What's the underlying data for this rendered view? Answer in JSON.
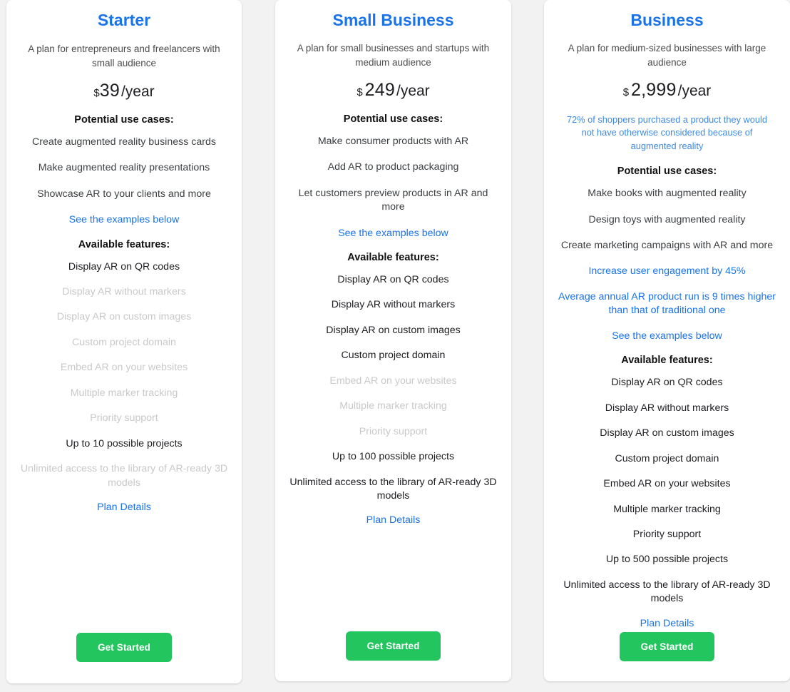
{
  "plans": [
    {
      "name": "Starter",
      "description": "A plan for entrepreneurs and freelancers with small audience",
      "price_currency": "$",
      "price_amount": "39",
      "price_period": "/year",
      "stat_note": null,
      "use_cases_heading": "Potential use cases:",
      "use_cases": [
        "Create augmented reality business cards",
        "Make augmented reality presentations",
        "Showcase AR to your clients and more"
      ],
      "examples_link": "See the examples below",
      "features_heading": "Available features:",
      "features": [
        {
          "label": "Display AR on QR codes",
          "enabled": true
        },
        {
          "label": "Display AR without markers",
          "enabled": false
        },
        {
          "label": "Display AR on custom images",
          "enabled": false
        },
        {
          "label": "Custom project domain",
          "enabled": false
        },
        {
          "label": "Embed AR on your websites",
          "enabled": false
        },
        {
          "label": "Multiple marker tracking",
          "enabled": false
        },
        {
          "label": "Priority support",
          "enabled": false
        },
        {
          "label": "Up to 10 possible projects",
          "enabled": true
        },
        {
          "label": "Unlimited access to the library of AR-ready 3D models",
          "enabled": false
        }
      ],
      "plan_details_link": "Plan Details",
      "cta_label": "Get Started"
    },
    {
      "name": "Small Business",
      "description": "A plan for small businesses and startups with medium audience",
      "price_currency": "$",
      "price_amount": "249",
      "price_period": "/year",
      "stat_note": null,
      "use_cases_heading": "Potential use cases:",
      "use_cases": [
        "Make consumer products with AR",
        "Add AR to product packaging",
        "Let customers preview products in AR and more"
      ],
      "examples_link": "See the examples below",
      "features_heading": "Available features:",
      "features": [
        {
          "label": "Display AR on QR codes",
          "enabled": true
        },
        {
          "label": "Display AR without markers",
          "enabled": true
        },
        {
          "label": "Display AR on custom images",
          "enabled": true
        },
        {
          "label": "Custom project domain",
          "enabled": true
        },
        {
          "label": "Embed AR on your websites",
          "enabled": false
        },
        {
          "label": "Multiple marker tracking",
          "enabled": false
        },
        {
          "label": "Priority support",
          "enabled": false
        },
        {
          "label": "Up to 100 possible projects",
          "enabled": true
        },
        {
          "label": "Unlimited access to the library of AR-ready 3D models",
          "enabled": true
        }
      ],
      "plan_details_link": "Plan Details",
      "cta_label": "Get Started"
    },
    {
      "name": "Business",
      "description": "A plan for medium-sized businesses with large audience",
      "price_currency": "$",
      "price_amount": "2,999",
      "price_period": "/year",
      "stat_note": "72% of shoppers purchased a product they would not have otherwise considered because of augmented reality",
      "use_cases_heading": "Potential use cases:",
      "use_cases": [
        "Make books with augmented reality",
        "Design toys with augmented reality",
        "Create marketing campaigns with AR and more"
      ],
      "extra_links": [
        "Increase user engagement by 45%",
        "Average annual AR product run is 9 times higher than that of traditional one"
      ],
      "examples_link": "See the examples below",
      "features_heading": "Available features:",
      "features": [
        {
          "label": "Display AR on QR codes",
          "enabled": true
        },
        {
          "label": "Display AR without markers",
          "enabled": true
        },
        {
          "label": "Display AR on custom images",
          "enabled": true
        },
        {
          "label": "Custom project domain",
          "enabled": true
        },
        {
          "label": "Embed AR on your websites",
          "enabled": true
        },
        {
          "label": "Multiple marker tracking",
          "enabled": true
        },
        {
          "label": "Priority support",
          "enabled": true
        },
        {
          "label": "Up to 500 possible projects",
          "enabled": true
        },
        {
          "label": "Unlimited access to the library of AR-ready 3D models",
          "enabled": true
        }
      ],
      "plan_details_link": "Plan Details",
      "cta_label": "Get Started"
    }
  ],
  "colors": {
    "title_blue": "#1a73e8",
    "link_blue": "#1a73e8",
    "stat_blue": "#3f8ae0",
    "cta_green": "#22c55e",
    "feature_enabled": "#3c4043",
    "feature_disabled": "#c9c9c9",
    "page_background": "#f2f2f2",
    "card_background": "#ffffff"
  }
}
